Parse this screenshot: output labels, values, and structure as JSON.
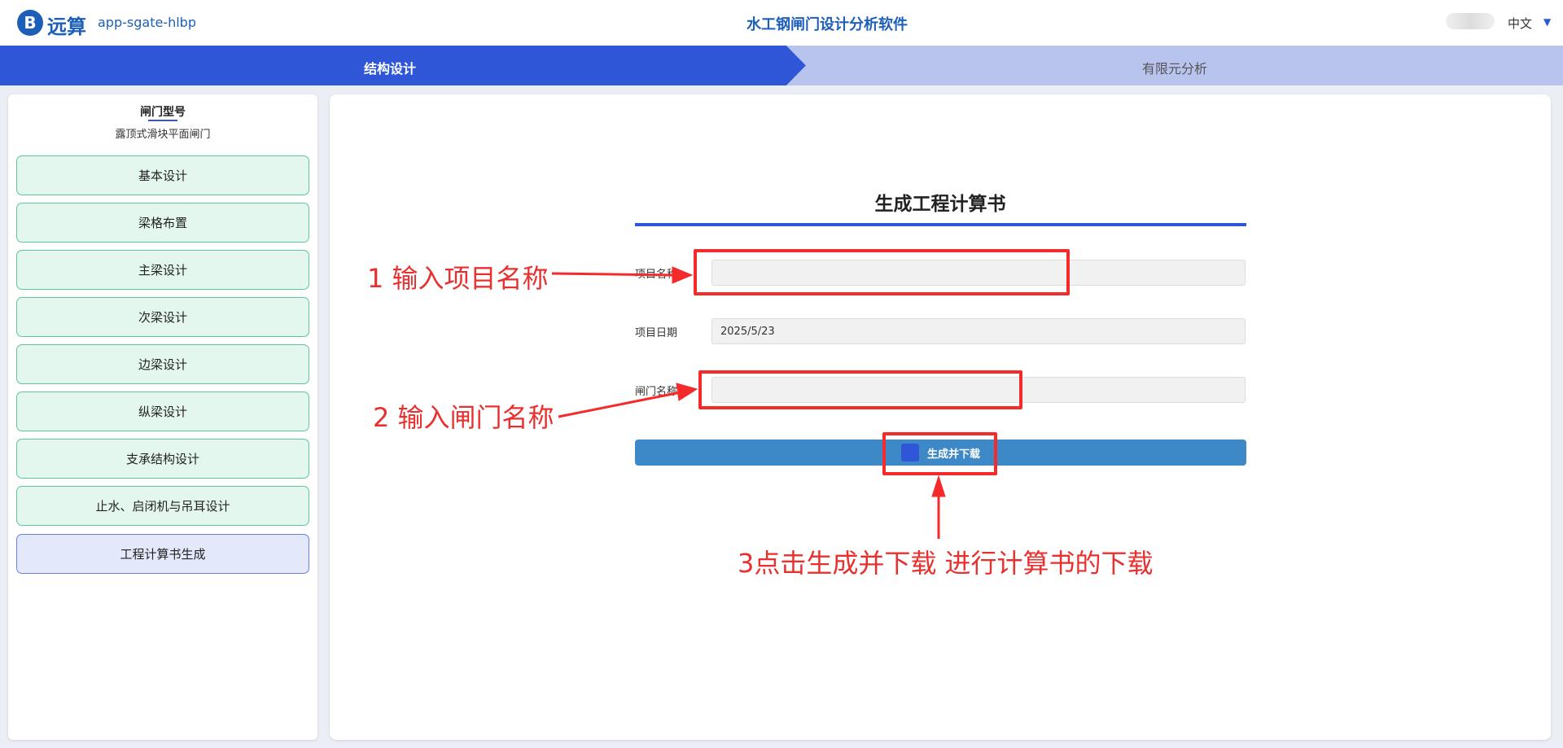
{
  "header": {
    "brand": "远算",
    "app_name": "app-sgate-hlbp",
    "title": "水工钢闸门设计分析软件",
    "language": "中文"
  },
  "steps": {
    "active": "结构设计",
    "inactive": "有限元分析"
  },
  "sidebar": {
    "gate_type_label": "闸门型号",
    "gate_type_value": "露顶式滑块平面闸门",
    "items": [
      {
        "label": "基本设计"
      },
      {
        "label": "梁格布置"
      },
      {
        "label": "主梁设计"
      },
      {
        "label": "次梁设计"
      },
      {
        "label": "边梁设计"
      },
      {
        "label": "纵梁设计"
      },
      {
        "label": "支承结构设计"
      },
      {
        "label": "止水、启闭机与吊耳设计"
      },
      {
        "label": "工程计算书生成"
      }
    ]
  },
  "form": {
    "title": "生成工程计算书",
    "project_name_label": "项目名称",
    "project_name_value": "",
    "project_date_label": "项目日期",
    "project_date_value": "2025/5/23",
    "gate_name_label": "闸门名称",
    "gate_name_value": "",
    "generate_button": "生成并下载"
  },
  "annotations": {
    "step1": "1 输入项目名称",
    "step2": "2 输入闸门名称",
    "step3": "3点击生成并下载 进行计算书的下载"
  },
  "colors": {
    "primary": "#2f56d6",
    "step_inactive": "#b8c3ee",
    "menu_bg": "#e4f7ef",
    "menu_border": "#5ec69b",
    "button": "#3d88c6",
    "annotation": "#f52a2a"
  }
}
